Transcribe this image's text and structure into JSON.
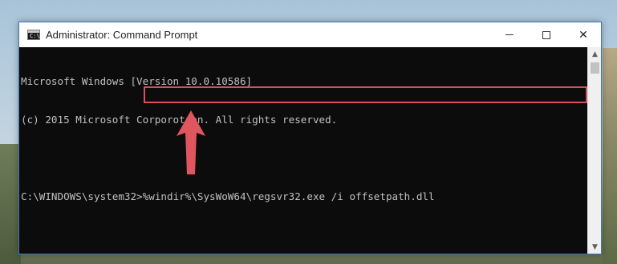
{
  "window": {
    "title": "Administrator: Command Prompt",
    "icon_text": "C:\\",
    "controls": {
      "minimize": "",
      "maximize": "",
      "close": "✕"
    }
  },
  "console": {
    "lines": [
      "Microsoft Windows [Version 10.0.10586]",
      "(c) 2015 Microsoft Corporotion. All rights reserved.",
      "",
      "C:\\WINDOWS\\system32>%windir%\\SysWoW64\\regsvr32.exe /i offsetpath.dll"
    ],
    "prompt": "C:\\WINDOWS\\system32>",
    "command": "%windir%\\SysWoW64\\regsvr32.exe /i offsetpath.dll"
  },
  "scrollbar": {
    "up_arrow": "▲",
    "down_arrow": "▼"
  },
  "colors": {
    "highlight": "#d8505a",
    "arrow": "#e0565e",
    "console_bg": "#0c0c0c",
    "console_text": "#c0c0c0"
  }
}
